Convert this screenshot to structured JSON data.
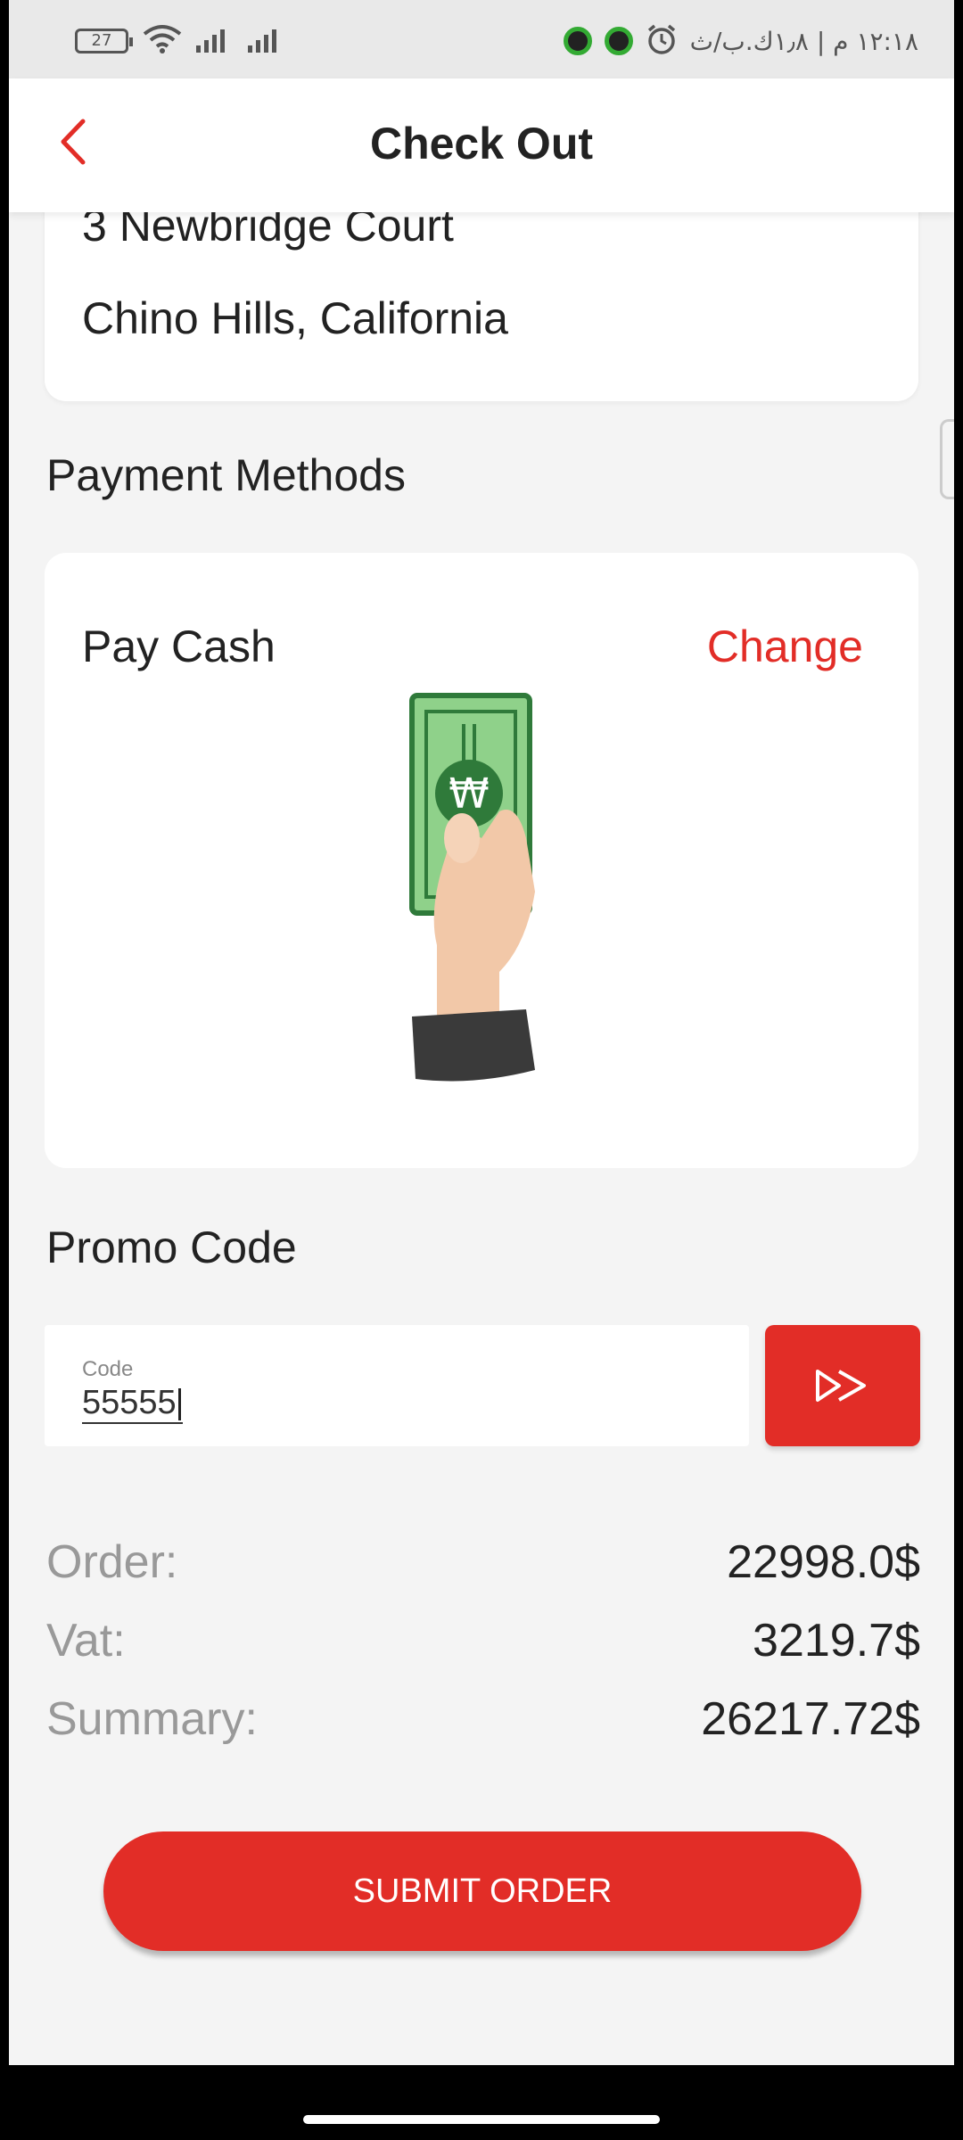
{
  "status_bar": {
    "battery": "27",
    "time": "١٢:١٨ م | ١٫٨ك.ب/ث"
  },
  "header": {
    "title": "Check Out"
  },
  "address": {
    "line1": "3 Newbridge Court",
    "line2": "Chino Hills, California"
  },
  "payment": {
    "section_title": "Payment Methods",
    "method": "Pay Cash",
    "change_label": "Change"
  },
  "promo": {
    "section_title": "Promo Code",
    "field_label": "Code",
    "value": "55555"
  },
  "totals": [
    {
      "label": "Order:",
      "value": "22998.0$"
    },
    {
      "label": "Vat:",
      "value": "3219.7$"
    },
    {
      "label": "Summary:",
      "value": "26217.72$"
    }
  ],
  "submit_label": "SUBMIT ORDER",
  "colors": {
    "accent": "#e22d27",
    "background": "#f4f4f4"
  }
}
